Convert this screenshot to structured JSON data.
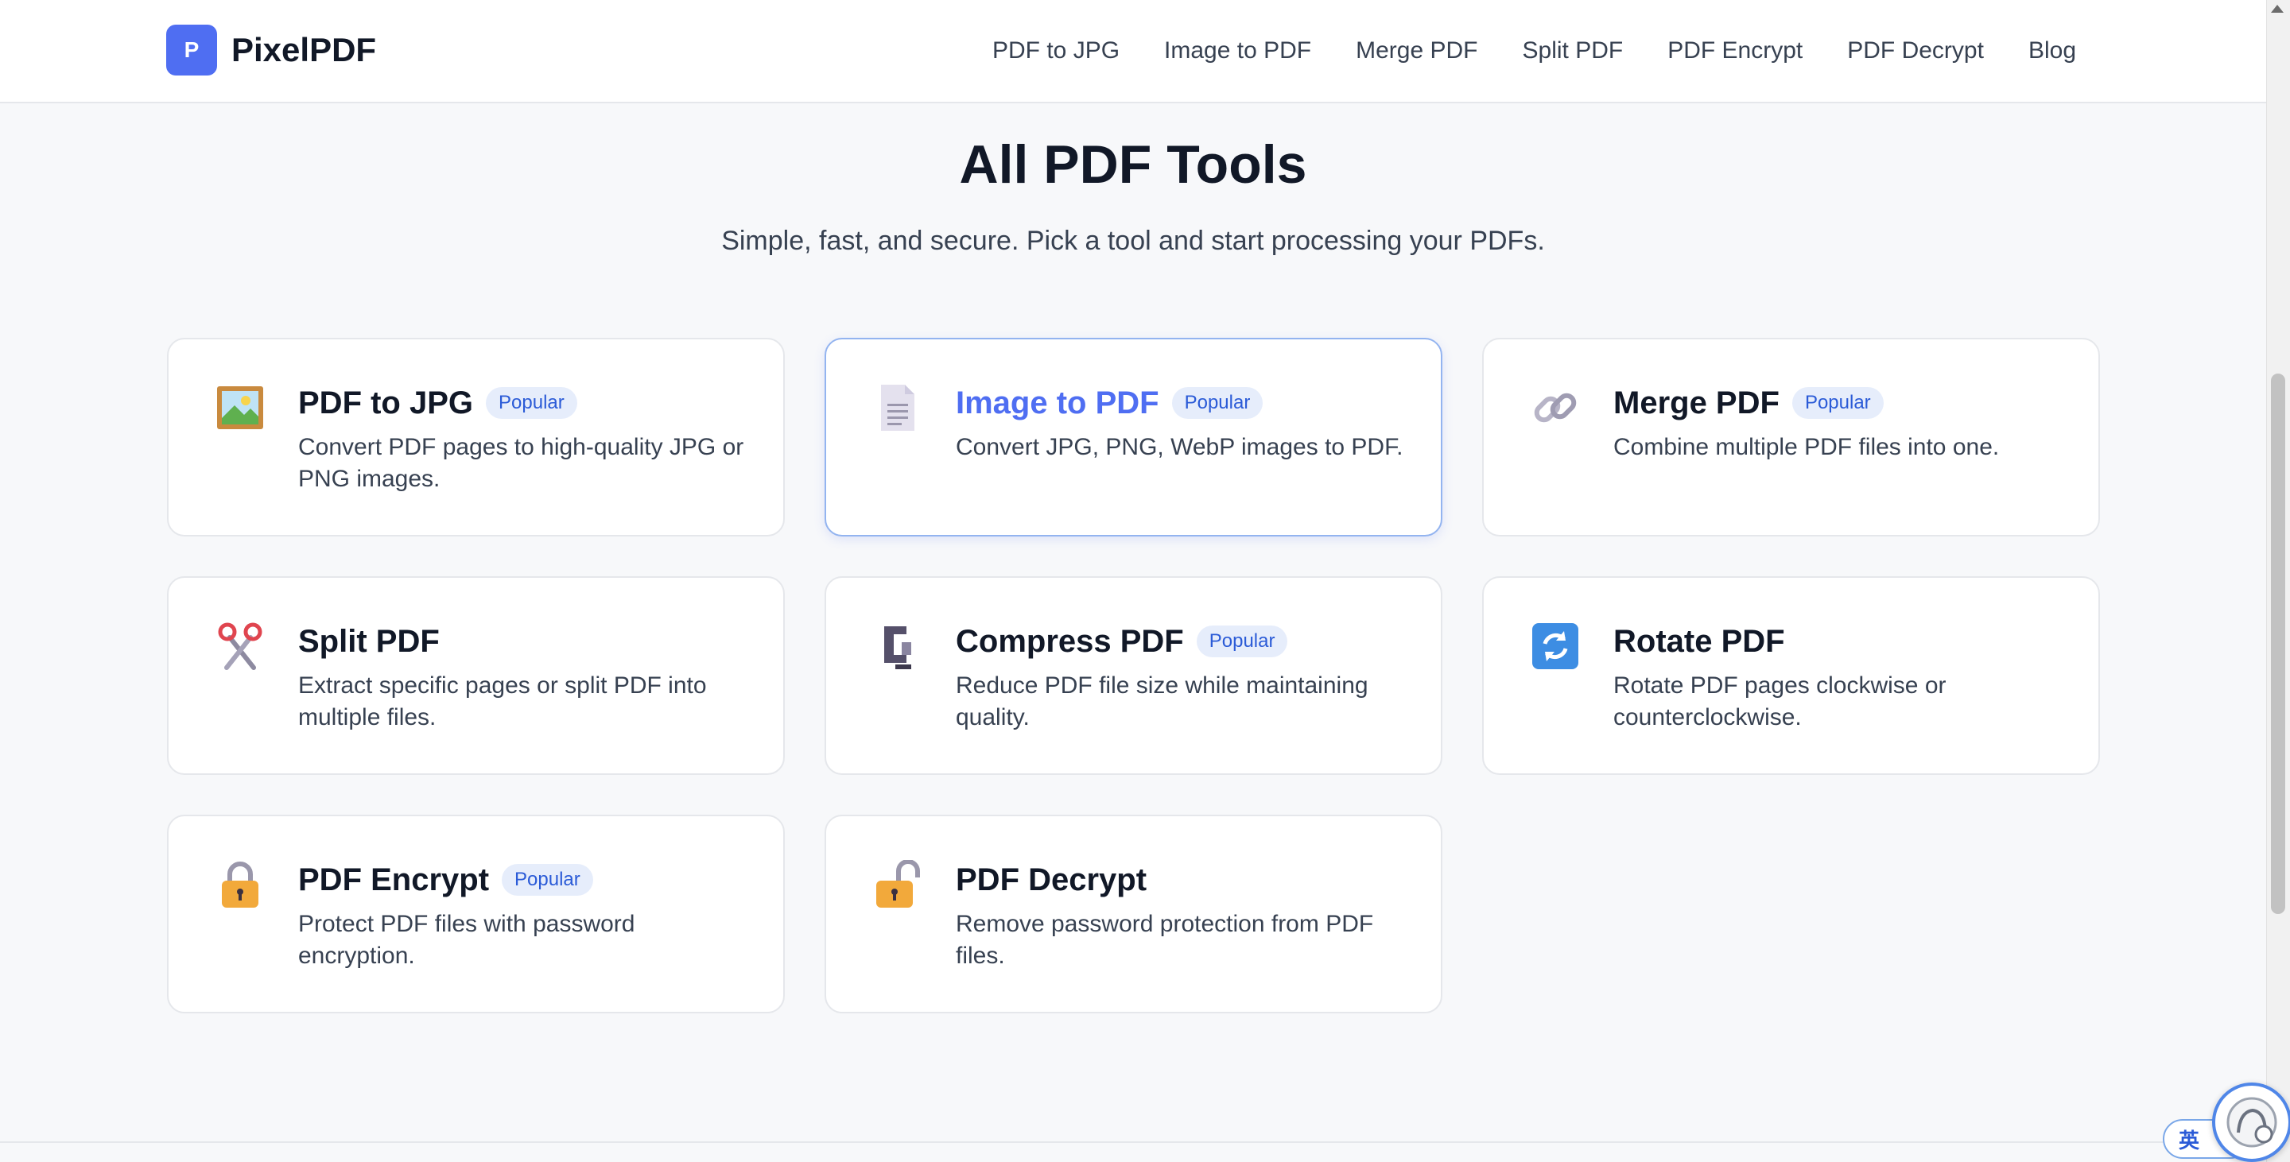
{
  "brand": {
    "logo_letter": "P",
    "name": "PixelPDF",
    "color": "#4f6ef2"
  },
  "nav": {
    "items": [
      "PDF to JPG",
      "Image to PDF",
      "Merge PDF",
      "Split PDF",
      "PDF Encrypt",
      "PDF Decrypt",
      "Blog"
    ]
  },
  "hero": {
    "title": "All PDF Tools",
    "subtitle": "Simple, fast, and secure. Pick a tool and start processing your PDFs."
  },
  "tools": [
    {
      "title": "PDF to JPG",
      "badge": "Popular",
      "desc": "Convert PDF pages to high-quality JPG or PNG images.",
      "icon": "framed-picture-icon"
    },
    {
      "title": "Image to PDF",
      "badge": "Popular",
      "desc": "Convert JPG, PNG, WebP images to PDF.",
      "icon": "document-icon",
      "active": true
    },
    {
      "title": "Merge PDF",
      "badge": "Popular",
      "desc": "Combine multiple PDF files into one.",
      "icon": "link-icon"
    },
    {
      "title": "Split PDF",
      "badge": "",
      "desc": "Extract specific pages or split PDF into multiple files.",
      "icon": "scissors-icon"
    },
    {
      "title": "Compress PDF",
      "badge": "Popular",
      "desc": "Reduce PDF file size while maintaining quality.",
      "icon": "clamp-icon"
    },
    {
      "title": "Rotate PDF",
      "badge": "",
      "desc": "Rotate PDF pages clockwise or counterclockwise.",
      "icon": "rotate-icon"
    },
    {
      "title": "PDF Encrypt",
      "badge": "Popular",
      "desc": "Protect PDF files with password encryption.",
      "icon": "lock-icon"
    },
    {
      "title": "PDF Decrypt",
      "badge": "",
      "desc": "Remove password protection from PDF files.",
      "icon": "unlock-icon"
    }
  ],
  "ime": {
    "label": "英"
  }
}
